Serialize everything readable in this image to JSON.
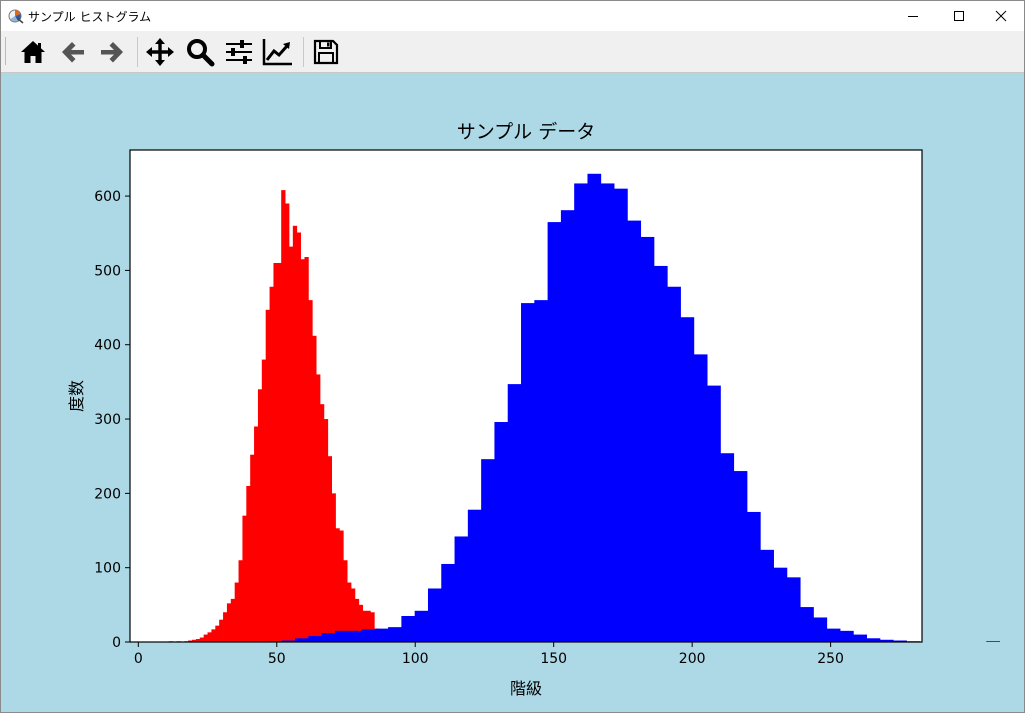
{
  "window": {
    "title": "サンプル ヒストグラム",
    "controls": [
      "minimize",
      "maximize",
      "close"
    ]
  },
  "toolbar": {
    "buttons": [
      {
        "icon": "home-icon",
        "name": "home-button"
      },
      {
        "icon": "back-arrow-icon",
        "name": "back-button"
      },
      {
        "icon": "forward-arrow-icon",
        "name": "forward-button"
      },
      {
        "icon": "pan-move-icon",
        "name": "pan-button"
      },
      {
        "icon": "zoom-magnifier-icon",
        "name": "zoom-button"
      },
      {
        "icon": "sliders-icon",
        "name": "configure-subplots-button"
      },
      {
        "icon": "trend-chart-icon",
        "name": "edit-axes-button"
      },
      {
        "icon": "floppy-disk-icon",
        "name": "save-button"
      }
    ]
  },
  "colors": {
    "figure_background": "#add8e6",
    "axes_background": "#ffffff",
    "series_red": "#ff0000",
    "series_blue": "#0000ff"
  },
  "chart_data": {
    "type": "bar",
    "title": "サンプル データ",
    "xlabel": "階級",
    "ylabel": "度数",
    "xlim": [
      -3,
      283
    ],
    "ylim": [
      0,
      662
    ],
    "xticks": [
      0,
      50,
      100,
      150,
      200,
      250
    ],
    "yticks": [
      0,
      100,
      200,
      300,
      400,
      500,
      600
    ],
    "grid": false,
    "legend": "none",
    "series": [
      {
        "color": "#ff0000",
        "bin_width": 1.4,
        "bin_start": 11.0,
        "values": [
          1,
          0,
          1,
          0,
          1,
          2,
          3,
          4,
          6,
          10,
          13,
          17,
          22,
          30,
          40,
          52,
          58,
          80,
          110,
          170,
          210,
          252,
          290,
          340,
          380,
          447,
          478,
          510,
          510,
          608,
          590,
          532,
          560,
          551,
          515,
          518,
          460,
          412,
          360,
          320,
          300,
          250,
          200,
          153,
          150,
          110,
          80,
          72,
          58,
          50,
          42,
          42,
          40,
          18,
          6
        ]
      },
      {
        "color": "#0000ff",
        "bin_width": 4.8,
        "bin_start": 47.0,
        "values": [
          1,
          2,
          5,
          8,
          12,
          15,
          15,
          17,
          18,
          20,
          35,
          42,
          72,
          105,
          142,
          178,
          246,
          296,
          347,
          456,
          460,
          565,
          581,
          617,
          630,
          617,
          610,
          567,
          545,
          506,
          478,
          437,
          387,
          345,
          254,
          230,
          175,
          124,
          100,
          87,
          47,
          33,
          18,
          15,
          10,
          5,
          3,
          2,
          1,
          0,
          0,
          0,
          0,
          0,
          1
        ]
      }
    ]
  }
}
